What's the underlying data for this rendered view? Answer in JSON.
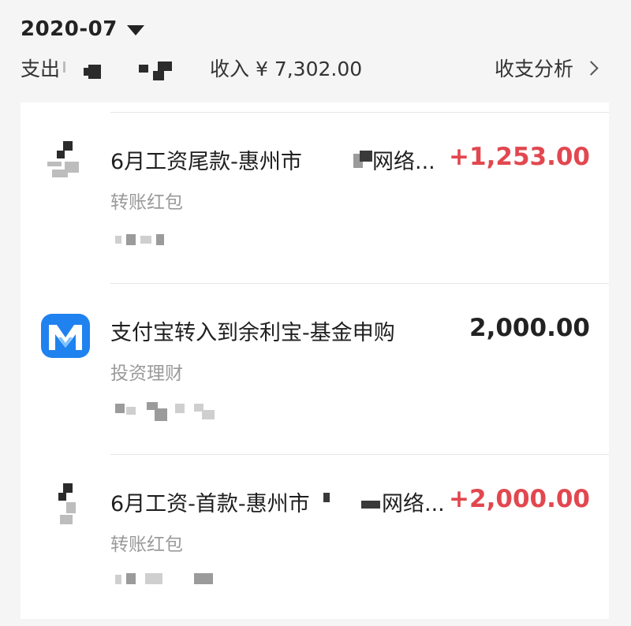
{
  "header": {
    "month": "2020-07",
    "expense_label": "支出",
    "income_text": "收入 ¥ 7,302.00",
    "analysis_label": "收支分析"
  },
  "colors": {
    "income_amount": "#e2474f",
    "neutral_amount": "#222222",
    "yu_e_bao_blue": "#1f82ef"
  },
  "transactions": [
    {
      "title": "6月工资尾款-惠州市",
      "title_tail": "网络...",
      "category": "转账红包",
      "amount": "+1,253.00",
      "icon": "redacted-avatar"
    },
    {
      "title": "支付宝转入到余利宝-基金申购",
      "category": "投资理财",
      "amount": "2,000.00",
      "icon": "yu-li-bao-icon"
    },
    {
      "title": "6月工资-首款-惠州市",
      "title_tail": "网络...",
      "category": "转账红包",
      "amount": "+2,000.00",
      "icon": "redacted-avatar"
    }
  ]
}
